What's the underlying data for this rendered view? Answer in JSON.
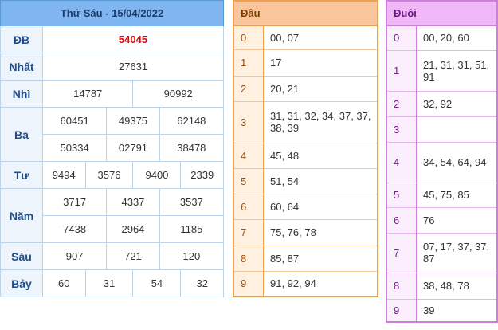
{
  "results": {
    "header": "Thứ Sáu - 15/04/2022",
    "rows": {
      "db": {
        "label": "ĐB",
        "values": [
          "54045"
        ]
      },
      "nhat": {
        "label": "Nhất",
        "values": [
          "27631"
        ]
      },
      "nhi": {
        "label": "Nhì",
        "values": [
          "14787",
          "90992"
        ]
      },
      "ba": {
        "label": "Ba",
        "values": [
          "60451",
          "49375",
          "62148",
          "50334",
          "02791",
          "38478"
        ]
      },
      "tu": {
        "label": "Tư",
        "values": [
          "9494",
          "3576",
          "9400",
          "2339"
        ]
      },
      "nam": {
        "label": "Năm",
        "values": [
          "3717",
          "4337",
          "3537",
          "7438",
          "2964",
          "1185"
        ]
      },
      "sau": {
        "label": "Sáu",
        "values": [
          "907",
          "721",
          "120"
        ]
      },
      "bay": {
        "label": "Bảy",
        "values": [
          "60",
          "31",
          "54",
          "32"
        ]
      }
    }
  },
  "dau": {
    "header": "Đầu",
    "rows": [
      {
        "k": "0",
        "v": "00, 07"
      },
      {
        "k": "1",
        "v": "17"
      },
      {
        "k": "2",
        "v": "20, 21"
      },
      {
        "k": "3",
        "v": "31, 31, 32, 34, 37, 37, 38, 39"
      },
      {
        "k": "4",
        "v": "45, 48"
      },
      {
        "k": "5",
        "v": "51, 54"
      },
      {
        "k": "6",
        "v": "60, 64"
      },
      {
        "k": "7",
        "v": "75, 76, 78"
      },
      {
        "k": "8",
        "v": "85, 87"
      },
      {
        "k": "9",
        "v": "91, 92, 94"
      }
    ]
  },
  "duoi": {
    "header": "Đuôi",
    "rows": [
      {
        "k": "0",
        "v": "00, 20, 60"
      },
      {
        "k": "1",
        "v": "21, 31, 31, 51, 91"
      },
      {
        "k": "2",
        "v": "32, 92"
      },
      {
        "k": "3",
        "v": ""
      },
      {
        "k": "4",
        "v": "34, 54, 64, 94"
      },
      {
        "k": "5",
        "v": "45, 75, 85"
      },
      {
        "k": "6",
        "v": "76"
      },
      {
        "k": "7",
        "v": "07, 17, 37, 37, 87"
      },
      {
        "k": "8",
        "v": "38, 48, 78"
      },
      {
        "k": "9",
        "v": "39"
      }
    ]
  }
}
